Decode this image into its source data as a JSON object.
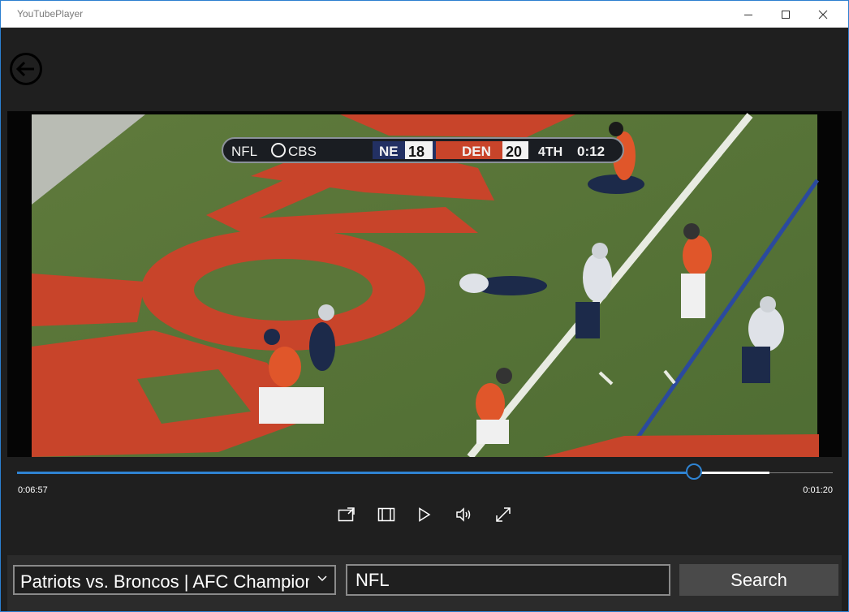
{
  "window": {
    "title": "YouTubePlayer",
    "controls": {
      "minimize_icon": "minimize-icon",
      "maximize_icon": "maximize-icon",
      "close_icon": "close-icon"
    }
  },
  "appbar": {
    "back_icon": "back-arrow-icon"
  },
  "video": {
    "scorebug": {
      "network": "NFL",
      "broadcaster": "CBS",
      "away_team": "NE",
      "away_score": "18",
      "home_team": "DEN",
      "home_score": "20",
      "quarter": "4TH",
      "clock": "0:12"
    }
  },
  "player": {
    "elapsed": "0:06:57",
    "remaining": "0:01:20",
    "progress_fraction": 0.833,
    "buffered_fraction": 0.925,
    "accent_color": "#2f84d3",
    "buttons": [
      "cast-icon",
      "aspect-ratio-icon",
      "play-icon",
      "volume-icon",
      "fullscreen-icon"
    ]
  },
  "bottom": {
    "video_select_value": "Patriots vs. Broncos | AFC Championship",
    "search_query": "NFL",
    "search_label": "Search"
  }
}
